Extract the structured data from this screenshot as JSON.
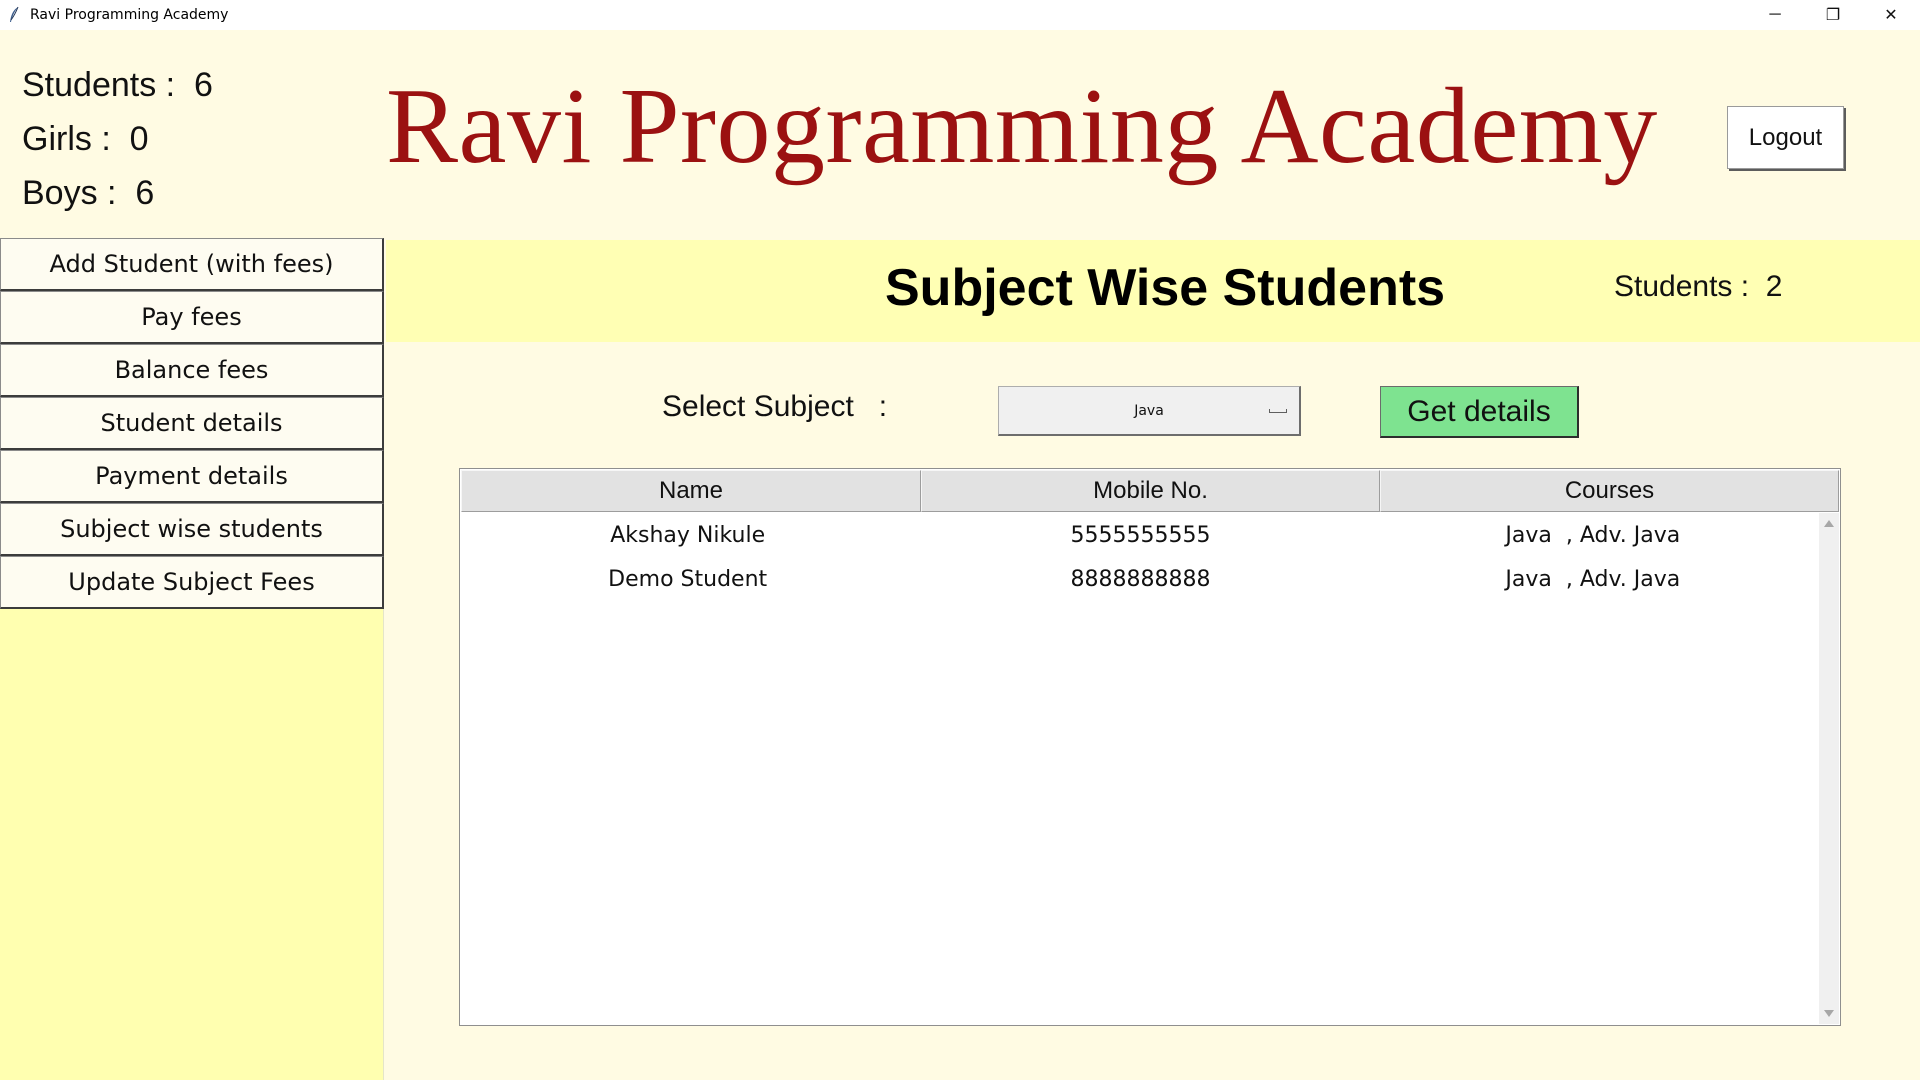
{
  "window": {
    "title": "Ravi Programming Academy",
    "controls": {
      "minimize": "─",
      "restore": "❐",
      "close": "✕"
    }
  },
  "stats": {
    "students_label": "Students :  ",
    "students_value": "6",
    "girls_label": "Girls :  ",
    "girls_value": "0",
    "boys_label": "Boys :  ",
    "boys_value": "6"
  },
  "header": {
    "title": "Ravi Programming Academy",
    "logout_label": "Logout",
    "title_color": "#9b1111"
  },
  "sidebar": {
    "items": [
      {
        "label": "Add Student (with fees)"
      },
      {
        "label": "Pay fees"
      },
      {
        "label": "Balance fees"
      },
      {
        "label": "Student details"
      },
      {
        "label": "Payment details"
      },
      {
        "label": "Subject wise students"
      },
      {
        "label": "Update Subject Fees"
      }
    ],
    "background": "#ffffb0"
  },
  "main": {
    "section_title": "Subject Wise Students",
    "count_label": "Students :  ",
    "count_value": "2",
    "select_label": "Select Subject   :",
    "selected_subject": "Java",
    "get_details_label": "Get details",
    "get_details_color": "#7ee390"
  },
  "table": {
    "columns": [
      "Name",
      "Mobile No.",
      "Courses"
    ],
    "rows": [
      [
        "Akshay Nikule",
        "5555555555",
        "Java  , Adv. Java"
      ],
      [
        "Demo Student",
        "8888888888",
        "Java  , Adv. Java"
      ]
    ]
  }
}
